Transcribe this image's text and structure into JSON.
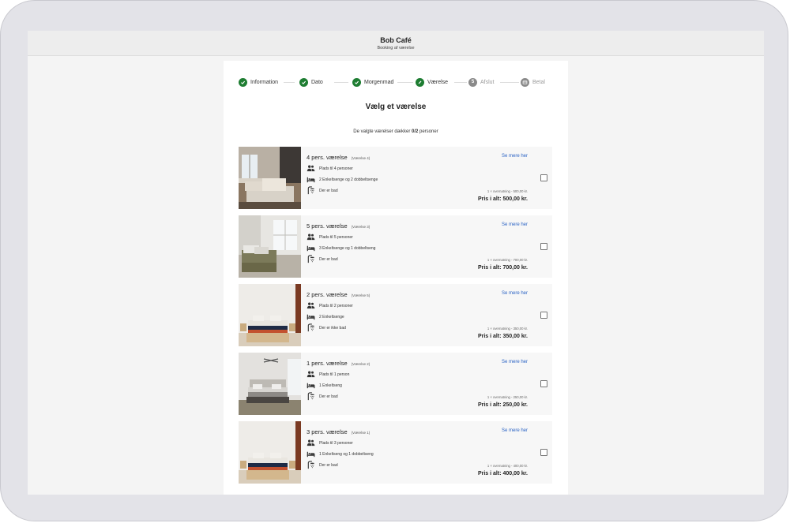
{
  "app": {
    "title": "Bob Café",
    "subtitle": "Booking af værelse"
  },
  "steps": [
    {
      "label": "Information",
      "state": "done",
      "icon": "check-icon"
    },
    {
      "label": "Dato",
      "state": "done",
      "icon": "check-icon"
    },
    {
      "label": "Morgenmad",
      "state": "done",
      "icon": "check-icon"
    },
    {
      "label": "Værelse",
      "state": "current",
      "icon": "pencil-icon"
    },
    {
      "label": "Afslut",
      "state": "pending",
      "number": "5"
    },
    {
      "label": "Betal",
      "state": "pending",
      "icon": "card-icon"
    }
  ],
  "heading": "Vælg et værelse",
  "summary": {
    "prefix": "De valgte værelser dækker ",
    "value": "0/2",
    "suffix": " personer"
  },
  "more_label": "Se mere her",
  "rooms": [
    {
      "title": "4 pers. værelse",
      "room_no": "(Værelse 4)",
      "capacity": "Plads til 4 personer",
      "beds_a": "2 Enkeltsenge",
      "beds_sep": "og",
      "beds_b": "2 dobbeltsenge",
      "bath": "Der er bad",
      "nights": "1 × overnatning - 500,00 kr.",
      "total": "Pris i alt: 500,00 kr."
    },
    {
      "title": "5 pers. værelse",
      "room_no": "(Værelse 3)",
      "capacity": "Plads til 5 personer",
      "beds_a": "3 Enkeltsenge",
      "beds_sep": "og",
      "beds_b": "1 dobbeltseng",
      "bath": "Der er bad",
      "nights": "1 × overnatning - 700,00 kr.",
      "total": "Pris i alt: 700,00 kr."
    },
    {
      "title": "2 pers. værelse",
      "room_no": "(Værelse 5)",
      "capacity": "Plads til 2 personer",
      "beds_a": "2 Enkeltsenge",
      "beds_sep": "",
      "beds_b": "",
      "bath": "Der er ikke bad",
      "nights": "1 × overnatning - 350,00 kr.",
      "total": "Pris i alt: 350,00 kr."
    },
    {
      "title": "1 pers. værelse",
      "room_no": "(Værelse 2)",
      "capacity": "Plads til 1 person",
      "beds_a": "1 Enkeltseng",
      "beds_sep": "",
      "beds_b": "",
      "bath": "Der er bad",
      "nights": "1 × overnatning - 250,00 kr.",
      "total": "Pris i alt: 250,00 kr."
    },
    {
      "title": "3 pers. værelse",
      "room_no": "(Værelse 1)",
      "capacity": "Plads til 3 personer",
      "beds_a": "1 Enkeltseng",
      "beds_sep": "og",
      "beds_b": "1 dobbeltseng",
      "bath": "Der er bad",
      "nights": "1 × overnatning - 400,00 kr.",
      "total": "Pris i alt: 400,00 kr."
    }
  ],
  "colors": {
    "done": "#1e7d32",
    "pending": "#8a8a8a",
    "link": "#2962c4"
  }
}
